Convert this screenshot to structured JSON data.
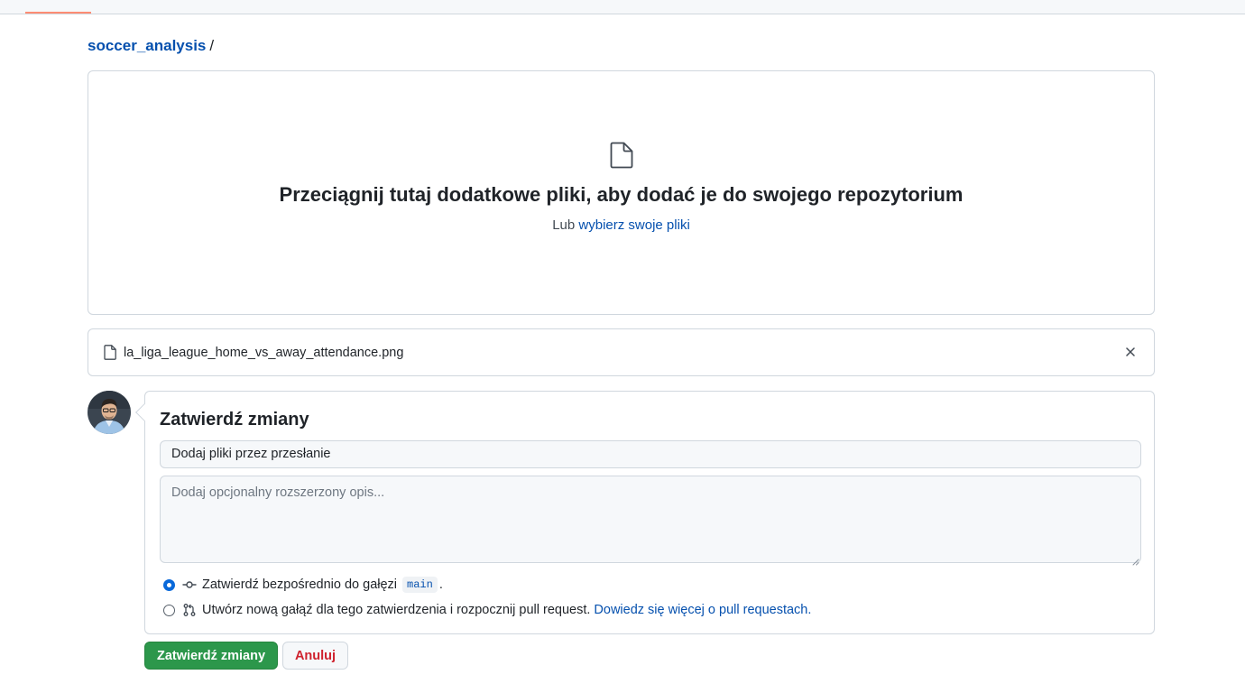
{
  "breadcrumb": {
    "repo": "soccer_analysis",
    "separator": "/"
  },
  "dropzone": {
    "icon": "file-icon",
    "title": "Przeciągnij tutaj dodatkowe pliki, aby dodać je do swojego repozytorium",
    "sub_prefix": "Lub",
    "sub_link": "wybierz swoje pliki"
  },
  "uploaded_file": {
    "icon": "file-icon",
    "name": "la_liga_league_home_vs_away_attendance.png",
    "remove_icon": "close-icon"
  },
  "commit": {
    "heading": "Zatwierdź zmiany",
    "summary_value": "Dodaj pliki przez przesłanie",
    "description_placeholder": "Dodaj opcjonalny rozszerzony opis...",
    "option_direct": {
      "label": "Zatwierdź bezpośrednio do gałęzi",
      "branch": "main",
      "suffix": ".",
      "icon": "git-commit-icon",
      "checked": true
    },
    "option_pr": {
      "label": "Utwórz nową gałąź dla tego zatwierdzenia i rozpocznij pull request.",
      "link": "Dowiedz się więcej o pull requestach.",
      "icon": "git-pull-request-icon",
      "checked": false
    }
  },
  "buttons": {
    "commit": "Zatwierdź zmiany",
    "cancel": "Anuluj"
  },
  "colors": {
    "primary": "#2c974b",
    "link": "#0550ae",
    "danger": "#cf222e",
    "accent": "#fd8c73"
  }
}
